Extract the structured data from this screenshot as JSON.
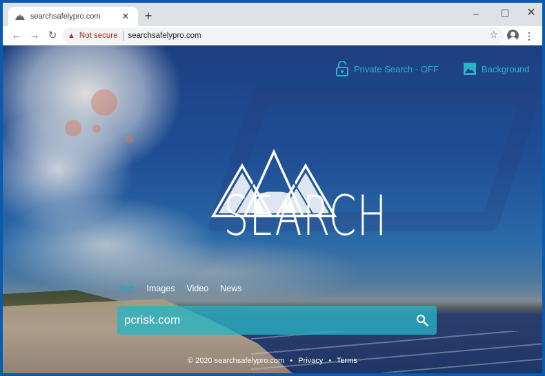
{
  "browser": {
    "tab": {
      "title": "searchsafelypro.com",
      "favicon": "mountain-icon"
    },
    "new_tab_label": "+",
    "window_controls": {
      "minimize": "–",
      "maximize": "☐",
      "close": "✕"
    },
    "toolbar": {
      "back": "←",
      "forward": "→",
      "reload": "↻",
      "security_warning": "Not secure",
      "url": "searchsafelypro.com",
      "bookmark": "☆",
      "menu": "⋮"
    }
  },
  "page": {
    "top_links": {
      "private_search": "Private Search - OFF",
      "background": "Background"
    },
    "logo_text": "SEARCH",
    "tabs": [
      {
        "label": "Web",
        "active": true
      },
      {
        "label": "Images",
        "active": false
      },
      {
        "label": "Video",
        "active": false
      },
      {
        "label": "News",
        "active": false
      }
    ],
    "search": {
      "value": "pcrisk.com",
      "placeholder": ""
    },
    "footer": {
      "copyright": "© 2020 searchsafelypro.com",
      "separator": "•",
      "privacy": "Privacy",
      "terms": "Terms"
    },
    "colors": {
      "accent": "#25b5c8",
      "search_bg": "#26b4c4",
      "security_warning": "#c5221f"
    }
  }
}
